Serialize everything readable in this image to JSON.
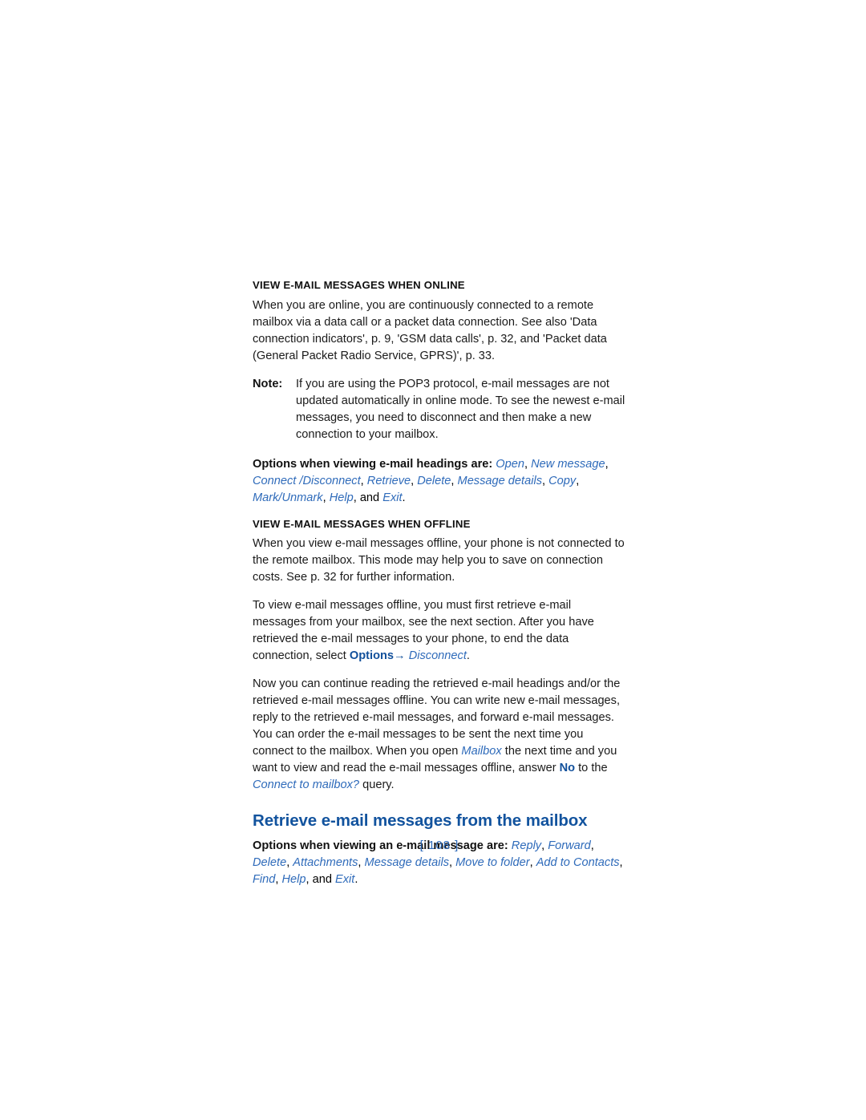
{
  "document": {
    "page_number_display": "[ 108 ]",
    "colors": {
      "chapter_heading_blue": "#12539E",
      "ui_item_blue": "#2F6BBA",
      "ui_key_blue": "#12509B",
      "body_text": "#1a1a1a"
    }
  },
  "sections": {
    "online": {
      "heading": "VIEW E-MAIL MESSAGES WHEN ONLINE",
      "paragraph": "When you are online, you are continuously connected to a remote mailbox via a data call or a packet data connection. See also 'Data connection indicators', p. 9, 'GSM data calls', p. 32, and 'Packet data (General Packet Radio Service, GPRS)', p. 33.",
      "note": {
        "label": "Note:",
        "text": "If you are using the POP3 protocol, e-mail messages are not updated automatically in online mode. To see the newest e-mail messages, you need to disconnect and then make a new connection to your mailbox."
      },
      "options": {
        "lead": "Options when viewing e-mail headings are:",
        "items": [
          "Open",
          "New message",
          "Connect /Disconnect",
          "Retrieve",
          "Delete",
          "Message details",
          "Copy",
          "Mark/Unmark",
          "Help",
          "Exit"
        ],
        "separator": ", ",
        "conjunction": "and",
        "terminator": "."
      }
    },
    "offline": {
      "heading": "VIEW E-MAIL MESSAGES WHEN OFFLINE",
      "paragraph_1": "When you view e-mail messages offline, your phone is not connected to the remote mailbox. This mode may help you to save on connection costs. See p. 32 for further information.",
      "paragraph_2": {
        "text_before": "To view e-mail messages offline, you must first retrieve e-mail messages from your mailbox, see the next section. After you have retrieved the e-mail messages to your phone, to end the data connection, select ",
        "key": "Options",
        "arrow": "→",
        "item": "Disconnect",
        "text_after": "."
      },
      "paragraph_3": {
        "part_1": "Now you can continue reading the retrieved e-mail headings and/or the retrieved e-mail messages offline. You can write new e-mail messages, reply to the retrieved e-mail messages, and forward e-mail messages. You can order the e-mail messages to be sent the next time you connect to the mailbox. When you open ",
        "item_1": "Mailbox",
        "part_2": " the next time and you want to view and read the e-mail messages offline, answer ",
        "key_1": "No",
        "part_3": " to the ",
        "item_2": "Connect to mailbox?",
        "part_4": " query."
      }
    },
    "retrieve": {
      "heading": "Retrieve e-mail messages from the mailbox",
      "options": {
        "lead": "Options when viewing an e-mail message are:",
        "items": [
          "Reply",
          "Forward",
          "Delete",
          "Attachments",
          "Message details",
          "Move to folder",
          "Add to Contacts",
          "Find",
          "Help",
          "Exit"
        ],
        "separator": ", ",
        "conjunction": "and",
        "terminator": "."
      }
    }
  }
}
